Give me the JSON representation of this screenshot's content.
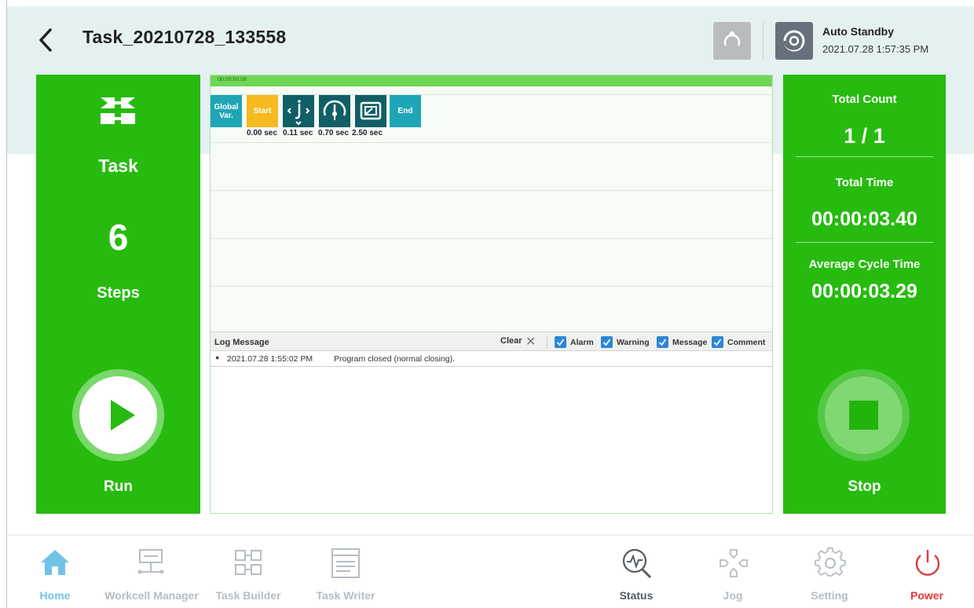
{
  "header": {
    "title": "Task_20210728_133558",
    "mode": "Auto Standby",
    "datetime": "2021.07.28 1:57:35 PM"
  },
  "left_panel": {
    "task_label": "Task",
    "step_count": "6",
    "steps_label": "Steps",
    "run_label": "Run"
  },
  "right_panel": {
    "total_count_label": "Total Count",
    "total_count": "1 / 1",
    "total_time_label": "Total Time",
    "total_time": "00:00:03.40",
    "avg_cycle_label": "Average Cycle Time",
    "avg_cycle": "00:00:03.29",
    "stop_label": "Stop"
  },
  "timeline": {
    "time_marker": "00:00:00.06",
    "blocks": [
      {
        "label": "Global Var.",
        "kind": "text",
        "color": "#1fa6b6"
      },
      {
        "label": "Start",
        "kind": "text",
        "color": "#f6b91f"
      },
      {
        "label": "",
        "kind": "icon",
        "icon": "joint-move-icon",
        "color": "#115f66"
      },
      {
        "label": "",
        "kind": "icon",
        "icon": "gauge-icon",
        "color": "#115f66"
      },
      {
        "label": "",
        "kind": "icon",
        "icon": "screen-icon",
        "color": "#115f66"
      },
      {
        "label": "End",
        "kind": "text",
        "color": "#1fa6b6"
      }
    ],
    "times": [
      "0.00 sec",
      "0.11 sec",
      "0.70 sec",
      "2.50 sec"
    ]
  },
  "log": {
    "title": "Log Message",
    "clear_label": "Clear",
    "filters": [
      {
        "label": "Alarm",
        "checked": true
      },
      {
        "label": "Warning",
        "checked": true
      },
      {
        "label": "Message",
        "checked": true
      },
      {
        "label": "Comment",
        "checked": true
      }
    ],
    "entries": [
      {
        "time": "2021.07.28 1:55:02 PM",
        "message": "Program closed (normal closing)."
      }
    ]
  },
  "nav": {
    "items": [
      {
        "label": "Home",
        "icon": "home-icon",
        "color": "#6fc3e8"
      },
      {
        "label": "Workcell Manager",
        "icon": "workcell-icon",
        "color": "#b6bdc3"
      },
      {
        "label": "Task Builder",
        "icon": "task-builder-icon",
        "color": "#b6bdc3"
      },
      {
        "label": "Task Writer",
        "icon": "task-writer-icon",
        "color": "#b6bdc3"
      },
      {
        "label": "Status",
        "icon": "status-icon",
        "color": "#555c63"
      },
      {
        "label": "Jog",
        "icon": "jog-icon",
        "color": "#b6bdc3"
      },
      {
        "label": "Setting",
        "icon": "gear-icon",
        "color": "#b6bdc3"
      },
      {
        "label": "Power",
        "icon": "power-icon",
        "color": "#e0383b"
      }
    ]
  },
  "colors": {
    "panel_green": "#27bb0f",
    "header_bg": "#e5f1f1",
    "accent_teal": "#115f66",
    "checkbox_blue": "#2d86d8"
  }
}
